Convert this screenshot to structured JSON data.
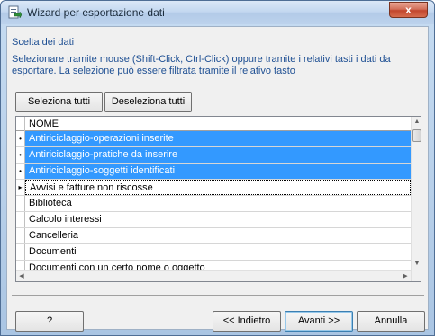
{
  "window": {
    "title": "Wizard per esportazione dati",
    "close_label": "x"
  },
  "section": {
    "title": "Scelta dei dati",
    "instructions_line1": "Selezionare tramite mouse (Shift-Click, Ctrl-Click) oppure tramite i  relativi tasti i dati da",
    "instructions_line2": "esportare. La selezione può essere filtrata tramite il relativo tasto"
  },
  "selection_buttons": {
    "select_all": "Seleziona tutti",
    "deselect_all": "Deseleziona tutti"
  },
  "grid": {
    "column_header": "NOME",
    "rows": [
      {
        "label": "Antiriciclaggio-operazioni inserite",
        "selected": true,
        "indicator": "•"
      },
      {
        "label": "Antiriciclaggio-pratiche da inserire",
        "selected": true,
        "indicator": "•"
      },
      {
        "label": "Antiriciclaggio-soggetti identificati",
        "selected": true,
        "indicator": "•"
      },
      {
        "label": "Avvisi e fatture non riscosse",
        "selected": false,
        "current": true,
        "indicator": "▸"
      },
      {
        "label": "Biblioteca",
        "selected": false,
        "indicator": ""
      },
      {
        "label": "Calcolo interessi",
        "selected": false,
        "indicator": ""
      },
      {
        "label": "Cancelleria",
        "selected": false,
        "indicator": ""
      },
      {
        "label": "Documenti",
        "selected": false,
        "indicator": ""
      },
      {
        "label": "Documenti con un certo nome o oggetto",
        "selected": false,
        "indicator": ""
      }
    ]
  },
  "footer": {
    "help_label": "?",
    "back_label": "<< Indietro",
    "next_label": "Avanti >>",
    "cancel_label": "Annulla"
  },
  "colors": {
    "selection": "#3399ff",
    "instruction_text": "#1e4f93"
  },
  "icons": {
    "app": "export-wizard-icon",
    "close": "close-icon",
    "scroll_up": "scroll-up-icon",
    "scroll_down": "scroll-down-icon",
    "scroll_left": "scroll-left-icon",
    "scroll_right": "scroll-right-icon"
  }
}
